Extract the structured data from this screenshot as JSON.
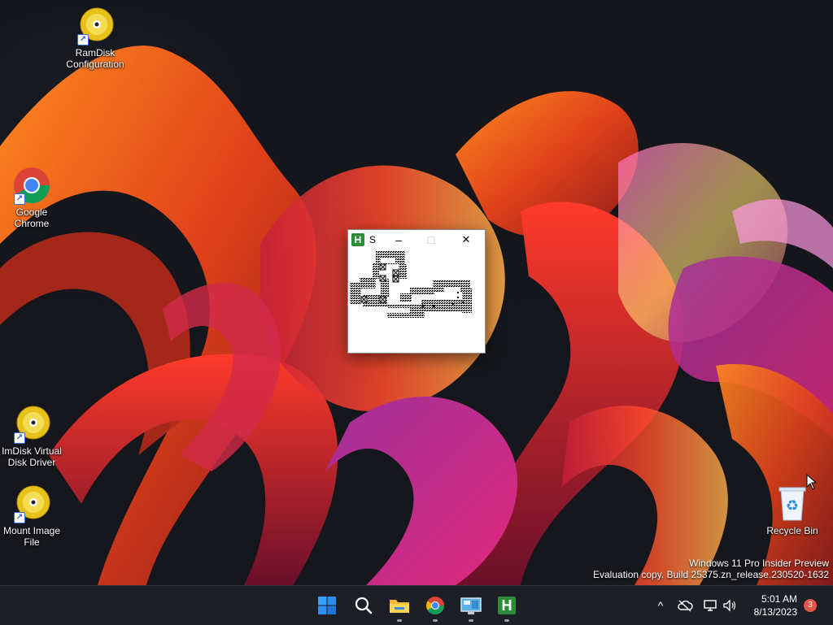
{
  "desktop": {
    "icons": [
      {
        "label": "RamDisk\nConfiguration",
        "icon": "disc-icon"
      },
      {
        "label": "Google\nChrome",
        "icon": "chrome-icon"
      },
      {
        "label": "ImDisk Virtual\nDisk Driver",
        "icon": "disc-icon"
      },
      {
        "label": "Mount Image\nFile",
        "icon": "disc-icon"
      },
      {
        "label": "Recycle Bin",
        "icon": "recycle-bin-icon"
      }
    ],
    "watermark": {
      "line1": "Windows 11 Pro Insider Preview",
      "line2": "Evaluation copy. Build 25375.zn_release.230520-1632"
    }
  },
  "window": {
    "title": "S",
    "app_icon_letter": "H",
    "minimize_label": "–",
    "maximize_label": "□",
    "close_label": "✕"
  },
  "taskbar": {
    "apps": [
      "start-icon",
      "search-icon",
      "file-explorer-icon",
      "chrome-icon",
      "control-panel-icon",
      "h-app-icon"
    ],
    "h_app_letter": "H",
    "tray": {
      "chevron": "^",
      "time": "5:01 AM",
      "date": "8/13/2023",
      "notification_count": "3"
    }
  },
  "colors": {
    "taskbar_bg": "#1c1f26",
    "accent_blue": "#2f8cf0",
    "h_app_green": "#2e8b3a",
    "badge_red": "#e8554a"
  }
}
